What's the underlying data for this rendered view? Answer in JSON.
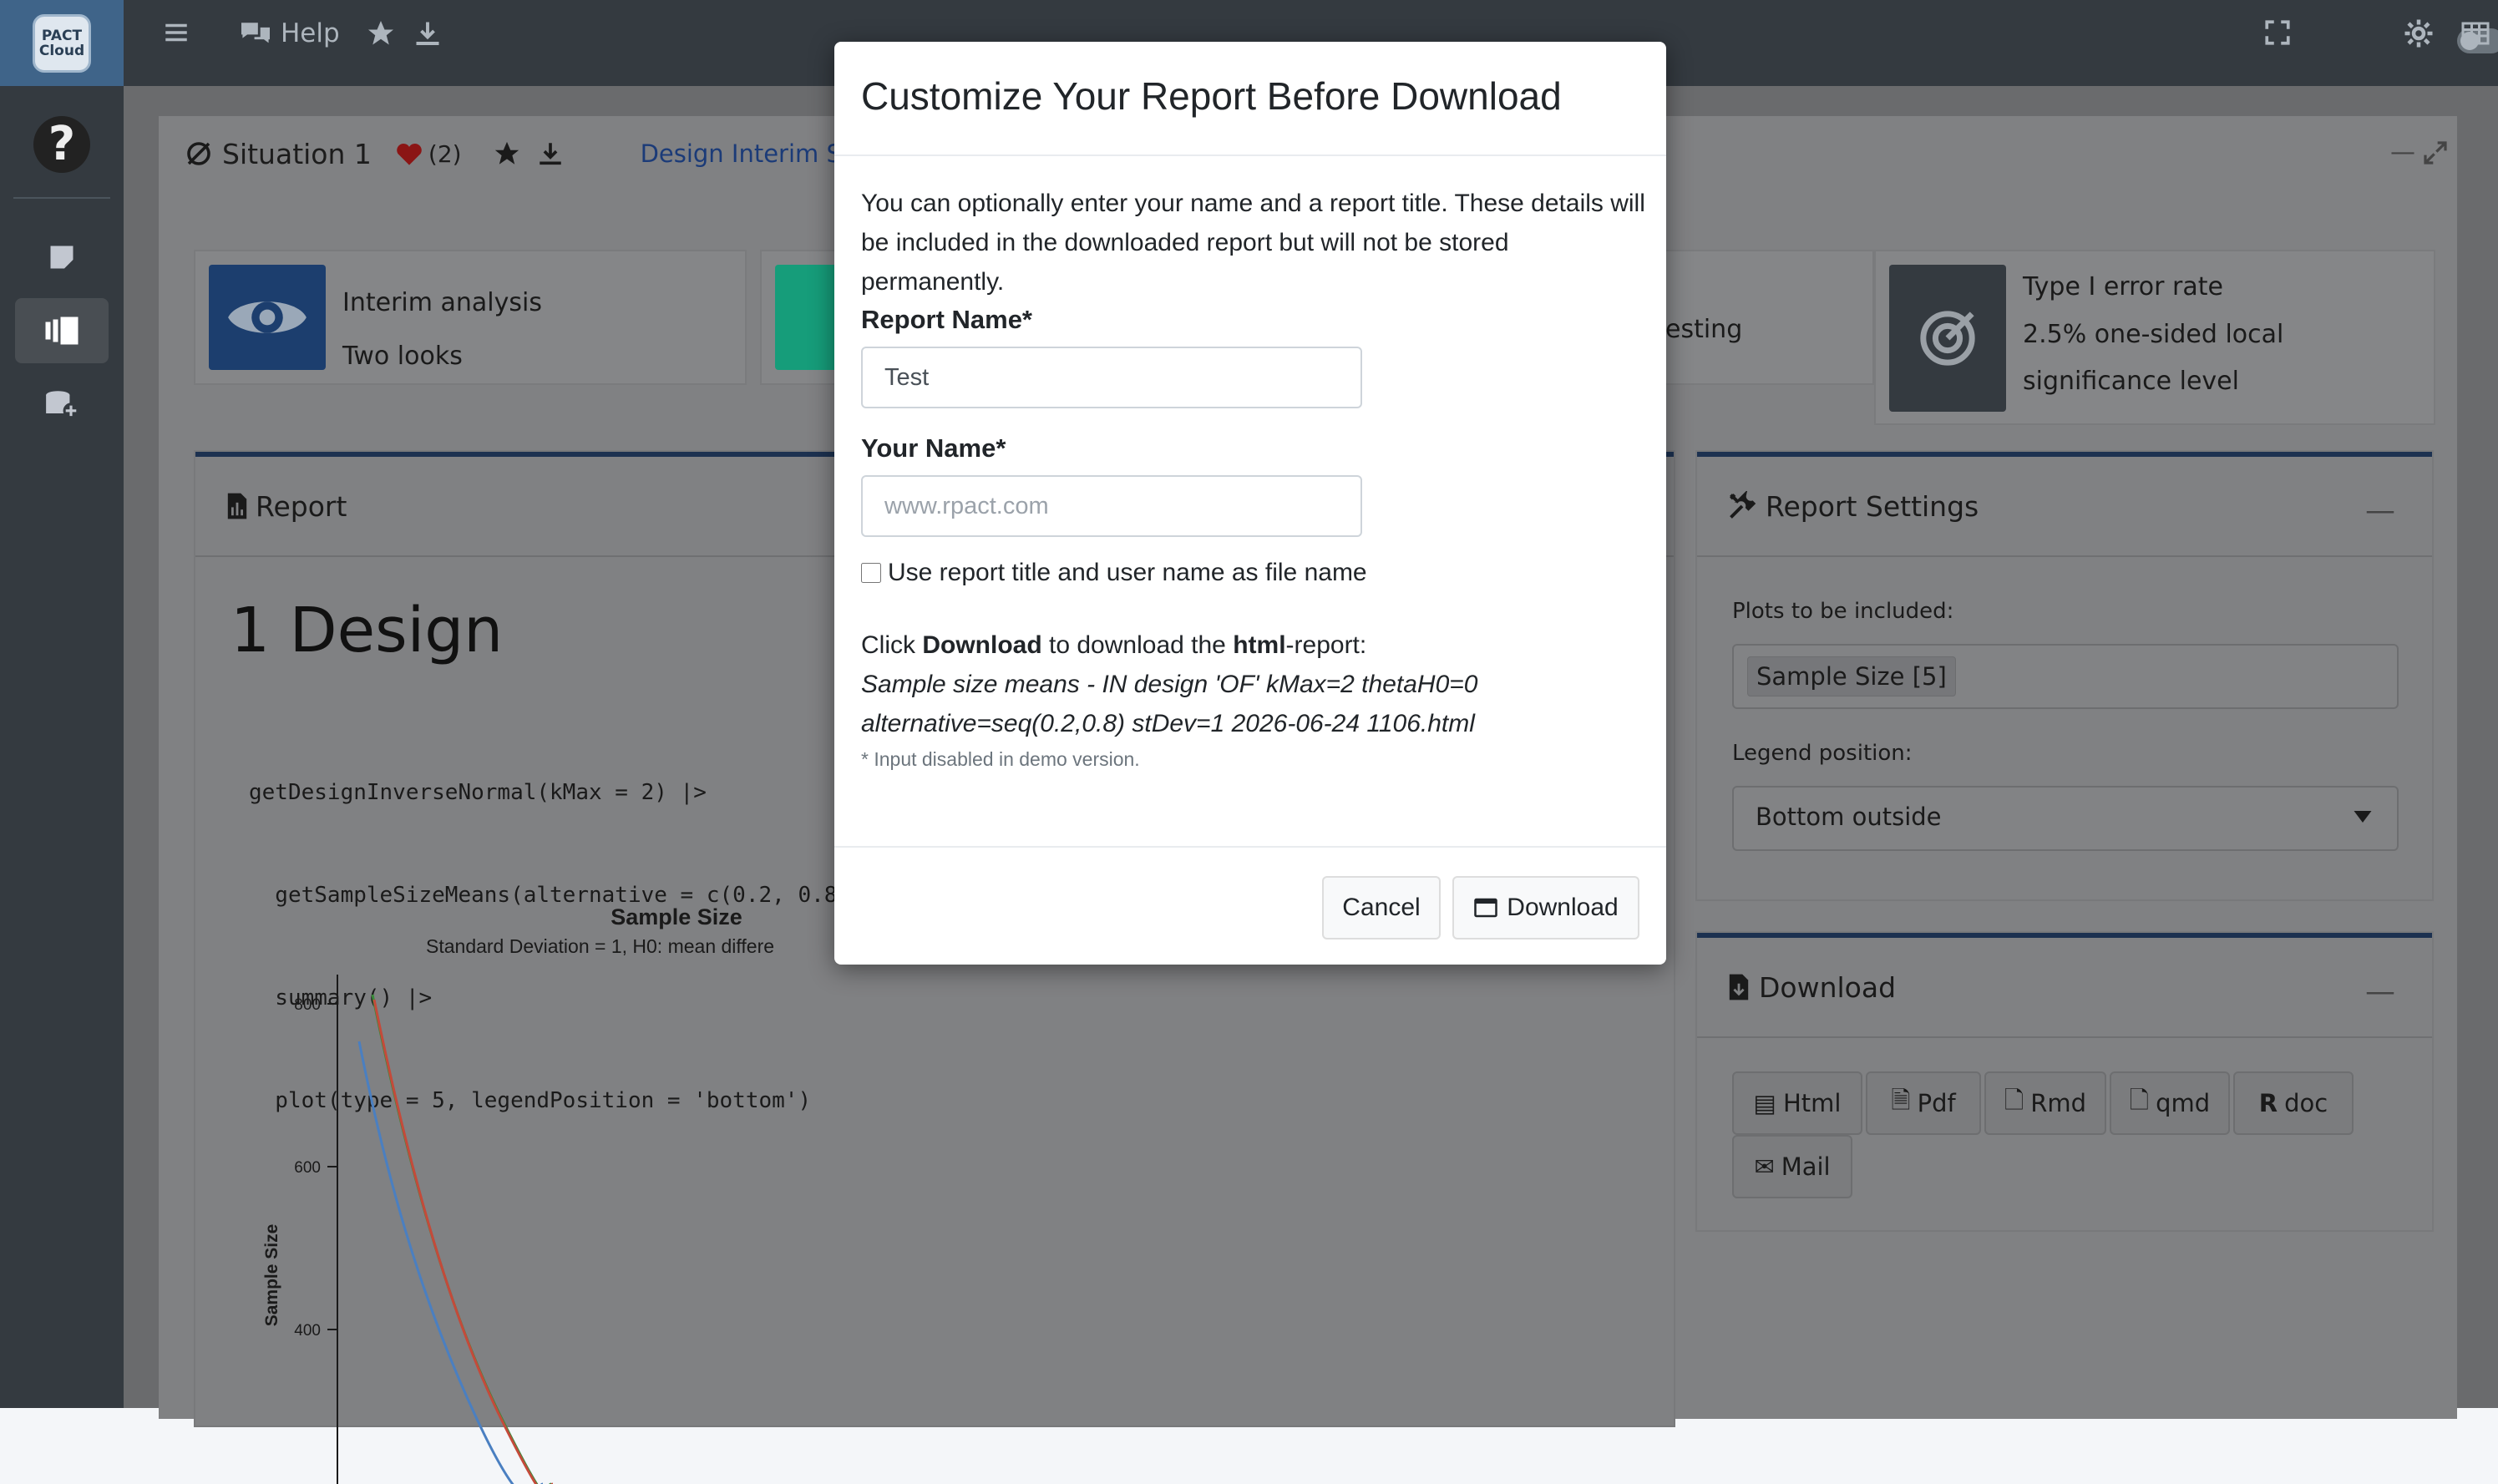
{
  "brand": {
    "logo_line1": "PACT",
    "logo_line2": "Cloud"
  },
  "header": {
    "help_label": "Help"
  },
  "situation": {
    "title": "Situation 1",
    "likes": "(2)",
    "tab": "Design Interim Stages"
  },
  "info_boxes": [
    {
      "title": "Interim analysis",
      "subtitle": "Two looks",
      "color": "#1c3e6e"
    },
    {
      "title": "",
      "subtitle": "esting",
      "color": "#169d7a"
    },
    {
      "title": "Type I error rate",
      "subtitle": "2.5% one-sided local significance level",
      "color": "#343a40"
    }
  ],
  "report_panel": {
    "title": "Report",
    "heading": "1 Design",
    "code_lines": [
      "getDesignInverseNormal(kMax = 2) |>",
      "  getSampleSizeMeans(alternative = c(0.2, 0.8))",
      "  summary() |>",
      "  plot(type = 5, legendPosition = 'bottom')"
    ]
  },
  "chart_data": {
    "type": "line",
    "title": "Sample Size",
    "subtitle": "Standard Deviation = 1, H0: mean differe",
    "ylabel": "Sample Size",
    "y_ticks": [
      400,
      600,
      800
    ],
    "series": [
      {
        "color": "#4a7fc1"
      },
      {
        "color": "#3a8a3a"
      },
      {
        "color": "#c44a3a"
      }
    ]
  },
  "settings_panel": {
    "title": "Report Settings",
    "plots_label": "Plots to be included:",
    "plots_value": "Sample Size [5]",
    "legend_label": "Legend position:",
    "legend_value": "Bottom outside"
  },
  "download_panel": {
    "title": "Download",
    "buttons": [
      "Html",
      "Pdf",
      "Rmd",
      "qmd",
      "doc",
      "Mail"
    ]
  },
  "modal": {
    "title": "Customize Your Report Before Download",
    "intro": "You can optionally enter your name and a report title. These details will be included in the downloaded report but will not be stored permanently.",
    "report_name_label": "Report Name*",
    "report_name_value": "Test",
    "your_name_label": "Your Name*",
    "your_name_placeholder": "www.rpact.com",
    "checkbox_label": "Use report title and user name as file name",
    "click_text": "Click",
    "download_word": "Download",
    "to_download_text": "to download the",
    "html_word": "html",
    "report_suffix": "-report:",
    "filename": "Sample size means - IN design 'OF' kMax=2 thetaH0=0 alternative=seq(0.2,0.8) stDev=1 2026-06-24 1106.html",
    "note": "* Input disabled in demo version.",
    "cancel_label": "Cancel",
    "download_label": "Download"
  }
}
